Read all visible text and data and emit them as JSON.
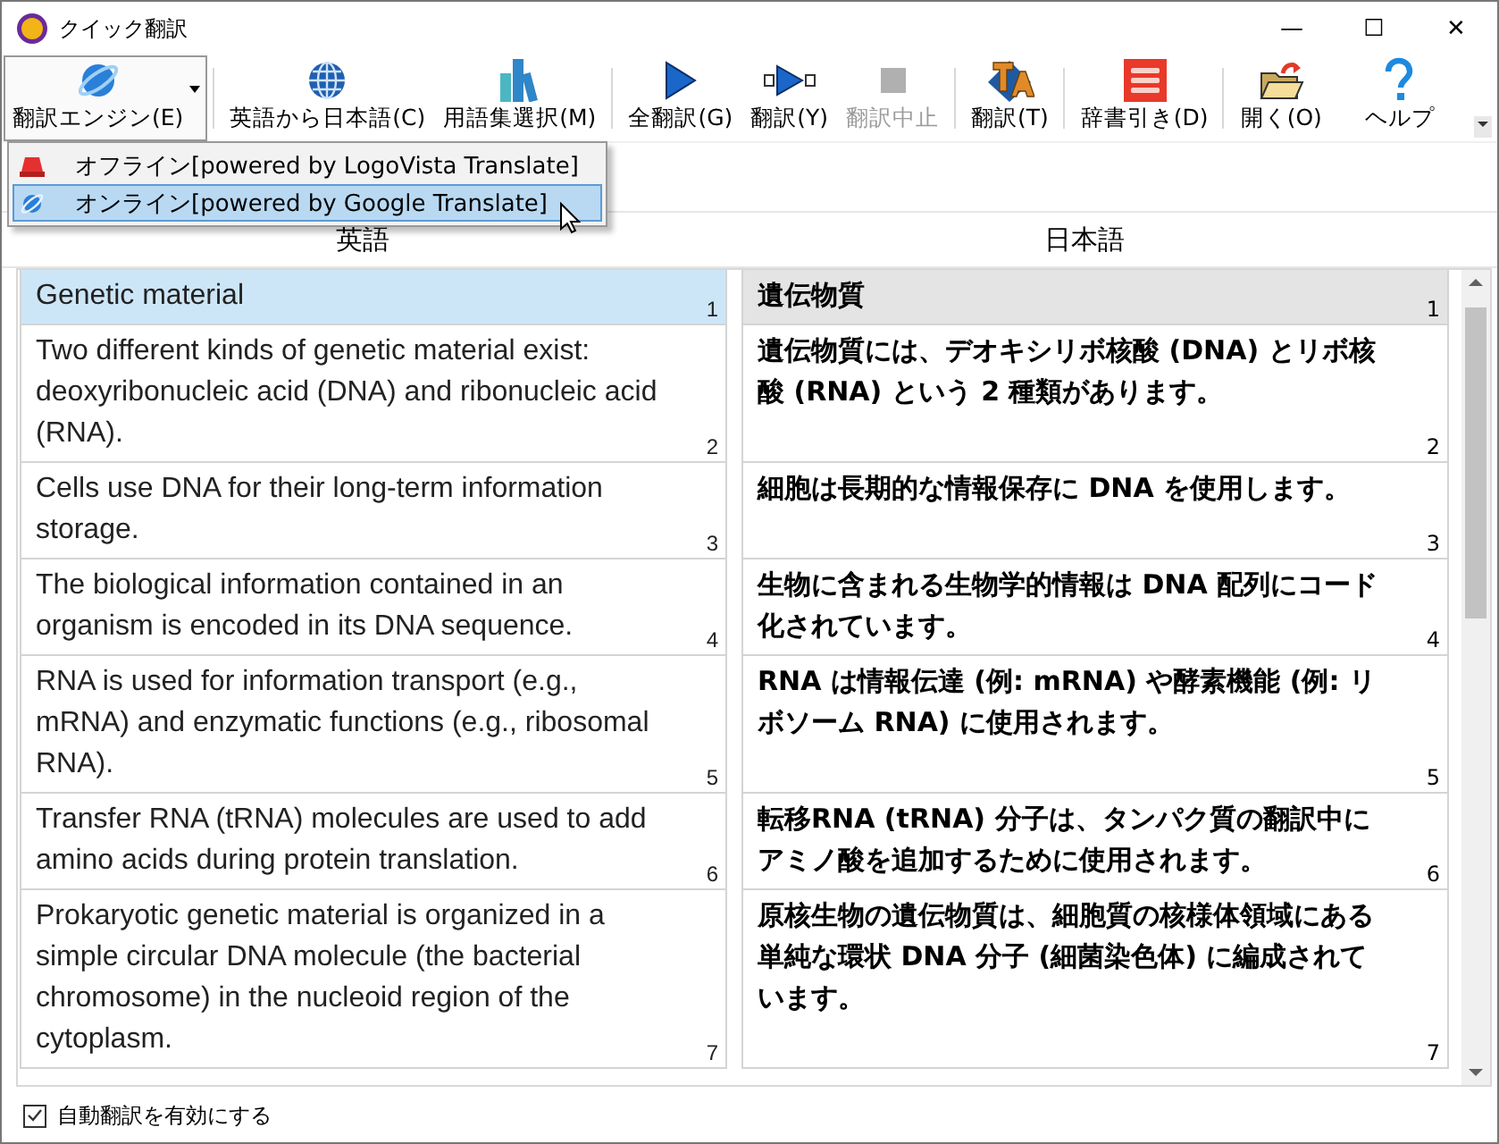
{
  "window": {
    "title": "クイック翻訳",
    "controls": [
      "—",
      "☐",
      "✕"
    ]
  },
  "toolbar": [
    {
      "label": "翻訳エンジン(E)",
      "pressed": true,
      "disabled": false,
      "separator_before": false,
      "dropdown": true
    },
    {
      "label": "英語から日本語(C)",
      "pressed": false,
      "disabled": false,
      "separator_before": true,
      "dropdown": false
    },
    {
      "label": "用語集選択(M)",
      "pressed": false,
      "disabled": false,
      "separator_before": false,
      "dropdown": false
    },
    {
      "label": "全翻訳(G)",
      "pressed": false,
      "disabled": false,
      "separator_before": true,
      "dropdown": false
    },
    {
      "label": "翻訳(Y)",
      "pressed": false,
      "disabled": false,
      "separator_before": false,
      "dropdown": false
    },
    {
      "label": "翻訳中止",
      "pressed": false,
      "disabled": true,
      "separator_before": false,
      "dropdown": false
    },
    {
      "label": "翻訳(T)",
      "pressed": false,
      "disabled": false,
      "separator_before": true,
      "dropdown": false
    },
    {
      "label": "辞書引き(D)",
      "pressed": false,
      "disabled": false,
      "separator_before": true,
      "dropdown": false
    },
    {
      "label": "開く(O)",
      "pressed": false,
      "disabled": false,
      "separator_before": true,
      "dropdown": false
    },
    {
      "label": "ヘルプ",
      "pressed": false,
      "disabled": false,
      "separator_before": false,
      "dropdown": false
    }
  ],
  "engine_menu": [
    {
      "label": "オフライン[powered by LogoVista Translate]",
      "selected": false
    },
    {
      "label": "オンライン[powered by Google Translate]",
      "selected": true
    }
  ],
  "columns": [
    "英語",
    "日本語"
  ],
  "rows": [
    {
      "source": "Genetic material",
      "source_number": "1",
      "target": "遺伝物質",
      "target_number": "1",
      "selected": true
    },
    {
      "source": "Two different kinds of genetic material exist: deoxyribonucleic acid (DNA) and ribonucleic acid (RNA).",
      "source_number": "2",
      "target": "遺伝物質には、デオキシリボ核酸 (DNA) とリボ核酸 (RNA) という 2 種類があります。",
      "target_number": "2",
      "selected": false
    },
    {
      "source": "Cells use DNA for their long-term information storage.",
      "source_number": "3",
      "target": "細胞は長期的な情報保存に DNA を使用します。",
      "target_number": "3",
      "selected": false
    },
    {
      "source": "The biological information contained in an organism is encoded in its DNA sequence.",
      "source_number": "4",
      "target": "生物に含まれる生物学的情報は DNA 配列にコード化されています。",
      "target_number": "4",
      "selected": false
    },
    {
      "source": "RNA is used for information transport (e.g., mRNA) and enzymatic functions (e.g., ribosomal RNA).",
      "source_number": "5",
      "target": "RNA は情報伝達 (例: mRNA) や酵素機能 (例: リボソーム RNA) に使用されます。",
      "target_number": "5",
      "selected": false
    },
    {
      "source": "Transfer RNA (tRNA) molecules are used to add amino acids during protein translation.",
      "source_number": "6",
      "target": "転移RNA (tRNA) 分子は、タンパク質の翻訳中にアミノ酸を追加するために使用されます。",
      "target_number": "6",
      "selected": false
    },
    {
      "source": "Prokaryotic genetic material is organized in a simple circular DNA molecule (the bacterial chromosome) in the nucleoid region of the cytoplasm.",
      "source_number": "7",
      "target": "原核生物の遺伝物質は、細胞質の核様体領域にある単純な環状 DNA 分子 (細菌染色体) に編成されています。",
      "target_number": "7",
      "selected": false
    }
  ],
  "auto_translate": {
    "label": "自動翻訳を有効にする",
    "checked": true
  }
}
